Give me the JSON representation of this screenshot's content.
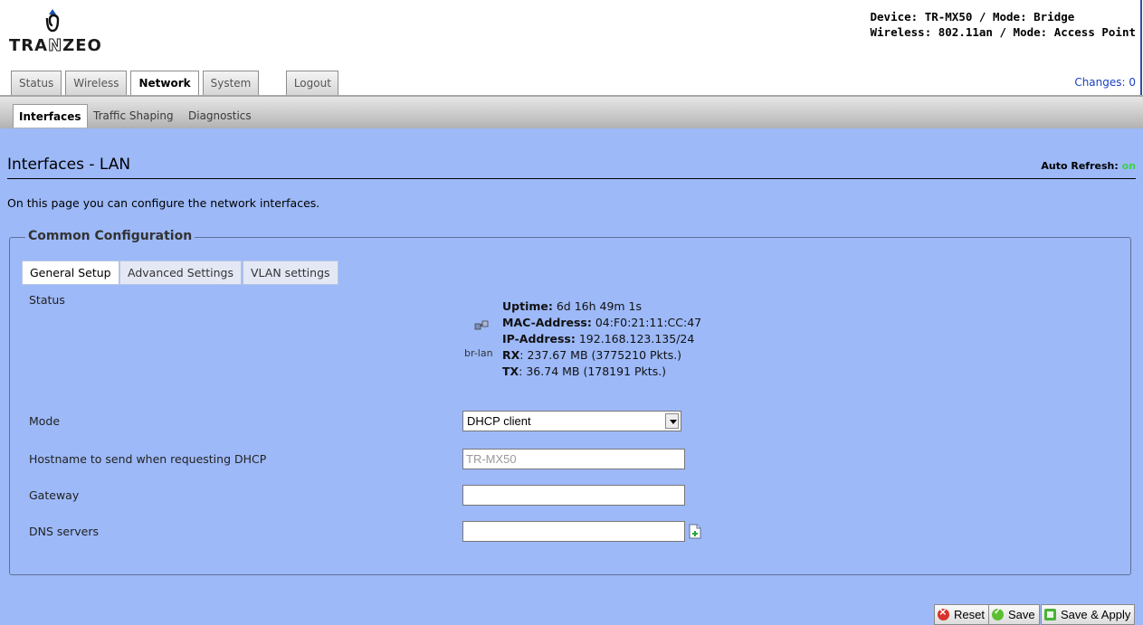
{
  "brand": {
    "logo_text_left": "TRA",
    "logo_text_mid": "N",
    "logo_text_right": "ZEO"
  },
  "device_info": {
    "line1": "Device: TR-MX50 / Mode: Bridge",
    "line2": "Wireless: 802.11an / Mode: Access Point"
  },
  "nav": {
    "tabs": [
      {
        "label": "Status"
      },
      {
        "label": "Wireless"
      },
      {
        "label": "Network",
        "active": true
      },
      {
        "label": "System"
      }
    ],
    "logout": "Logout",
    "changes": "Changes: 0"
  },
  "subnav": {
    "tabs": [
      {
        "label": "Interfaces",
        "active": true
      },
      {
        "label": "Traffic Shaping"
      },
      {
        "label": "Diagnostics"
      }
    ]
  },
  "page": {
    "title": "Interfaces - LAN",
    "auto_refresh_label": "Auto Refresh:",
    "auto_refresh_value": "on",
    "description": "On this page you can configure the network interfaces."
  },
  "config": {
    "legend": "Common Configuration",
    "tabs": [
      "General Setup",
      "Advanced Settings",
      "VLAN settings"
    ],
    "status": {
      "label": "Status",
      "interface": "br-lan",
      "uptime_label": "Uptime:",
      "uptime": "6d 16h 49m 1s",
      "mac_label": "MAC-Address:",
      "mac": "04:F0:21:11:CC:47",
      "ip_label": "IP-Address:",
      "ip": "192.168.123.135/24",
      "rx_label": "RX",
      "rx": ": 237.67 MB (3775210 Pkts.)",
      "tx_label": "TX",
      "tx": ": 36.74 MB (178191 Pkts.)"
    },
    "mode": {
      "label": "Mode",
      "value": "DHCP client"
    },
    "hostname": {
      "label": "Hostname to send when requesting DHCP",
      "placeholder": "TR-MX50"
    },
    "gateway": {
      "label": "Gateway",
      "value": ""
    },
    "dns": {
      "label": "DNS servers",
      "value": ""
    }
  },
  "actions": {
    "reset": "Reset",
    "save": "Save",
    "save_apply": "Save & Apply"
  },
  "colors": {
    "page_bg": "#9db9f8",
    "link_blue": "#1a3fc4",
    "on_green": "#3bd34a"
  }
}
